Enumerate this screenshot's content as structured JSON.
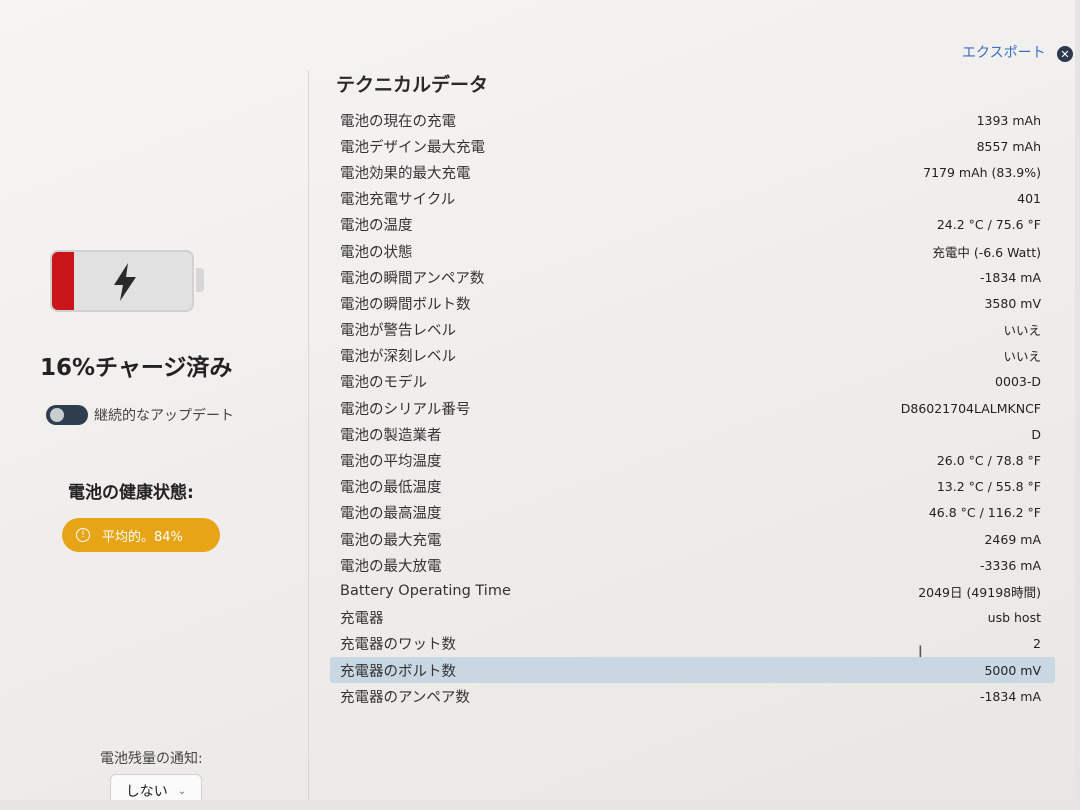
{
  "left": {
    "charge_percent": 16,
    "charge_text": "16%チャージ済み",
    "continuous_update_label": "継続的なアップデート",
    "continuous_update_on": false,
    "health_title": "電池の健康状態:",
    "health_badge": "平均的。84%",
    "notify_label": "電池残量の通知:",
    "notify_value": "しない"
  },
  "header": {
    "export_label": "エクスポート"
  },
  "tech": {
    "title": "テクニカルデータ",
    "rows": [
      {
        "label": "電池の現在の充電",
        "value": "1393 mAh"
      },
      {
        "label": "電池デザイン最大充電",
        "value": "8557 mAh"
      },
      {
        "label": "電池効果的最大充電",
        "value": "7179 mAh (83.9%)"
      },
      {
        "label": "電池充電サイクル",
        "value": "401"
      },
      {
        "label": "電池の温度",
        "value": "24.2 °C / 75.6 °F"
      },
      {
        "label": "電池の状態",
        "value": "充電中 (-6.6 Watt)"
      },
      {
        "label": "電池の瞬間アンペア数",
        "value": "-1834 mA"
      },
      {
        "label": "電池の瞬間ボルト数",
        "value": "3580 mV"
      },
      {
        "label": "電池が警告レベル",
        "value": "いいえ"
      },
      {
        "label": "電池が深刻レベル",
        "value": "いいえ"
      },
      {
        "label": "電池のモデル",
        "value": "0003-D"
      },
      {
        "label": "電池のシリアル番号",
        "value": "D86021704LALMKNCF"
      },
      {
        "label": "電池の製造業者",
        "value": "D"
      },
      {
        "label": "電池の平均温度",
        "value": "26.0 °C / 78.8 °F"
      },
      {
        "label": "電池の最低温度",
        "value": "13.2 °C / 55.8 °F"
      },
      {
        "label": "電池の最高温度",
        "value": "46.8 °C / 116.2 °F"
      },
      {
        "label": "電池の最大充電",
        "value": "2469 mA"
      },
      {
        "label": "電池の最大放電",
        "value": "-3336 mA"
      },
      {
        "label": "Battery Operating Time",
        "value": "2049日 (49198時間)"
      },
      {
        "label": "充電器",
        "value": "usb host"
      },
      {
        "label": "充電器のワット数",
        "value": "2"
      },
      {
        "label": "充電器のボルト数",
        "value": "5000 mV"
      },
      {
        "label": "充電器のアンペア数",
        "value": "-1834 mA"
      }
    ]
  }
}
